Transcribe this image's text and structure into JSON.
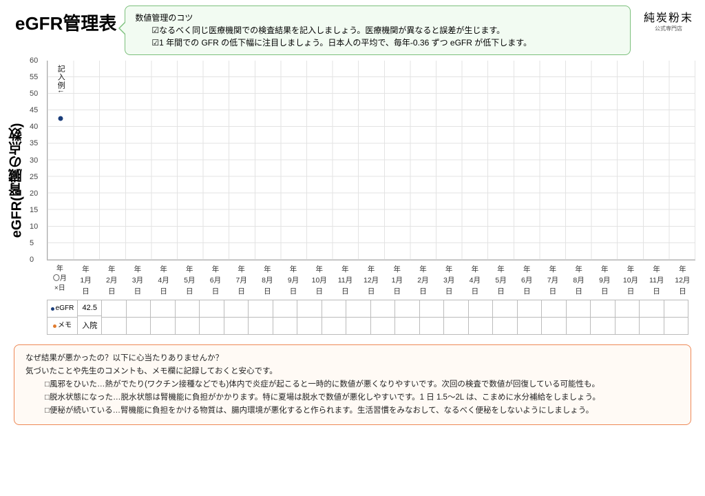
{
  "header": {
    "title": "eGFR管理表",
    "brand_line1": "純炭粉末",
    "brand_line2": "公式専門店",
    "tip_title": "数値管理のコツ",
    "tip1": "☑なるべく同じ医療機関での検査結果を記入しましょう。医療機関が異なると誤差が生じます。",
    "tip2": "☑1 年間での GFR の低下幅に注目しましょう。日本人の平均で、毎年-0.36 ずつ eGFR が低下します。"
  },
  "chart": {
    "ylabel": "eGFR(腎臓の点数)",
    "annotation": "記入例↓",
    "yticks": [
      "0",
      "5",
      "10",
      "15",
      "20",
      "25",
      "30",
      "35",
      "40",
      "45",
      "50",
      "55",
      "60"
    ]
  },
  "chart_data": {
    "type": "line",
    "title": "eGFR管理表",
    "ylabel": "eGFR(腎臓の点数)",
    "xlabel": "",
    "ylim": [
      0,
      60
    ],
    "categories": [
      "記入例",
      "1月",
      "2月",
      "3月",
      "4月",
      "5月",
      "6月",
      "7月",
      "8月",
      "9月",
      "10月",
      "11月",
      "12月",
      "1月",
      "2月",
      "3月",
      "4月",
      "5月",
      "6月",
      "7月",
      "8月",
      "9月",
      "10月",
      "11月",
      "12月"
    ],
    "series": [
      {
        "name": "eGFR",
        "values": [
          42.5,
          null,
          null,
          null,
          null,
          null,
          null,
          null,
          null,
          null,
          null,
          null,
          null,
          null,
          null,
          null,
          null,
          null,
          null,
          null,
          null,
          null,
          null,
          null,
          null
        ]
      },
      {
        "name": "メモ",
        "values": [
          "入院",
          "",
          "",
          "",
          "",
          "",
          "",
          "",
          "",
          "",
          "",
          "",
          "",
          "",
          "",
          "",
          "",
          "",
          "",
          "",
          "",
          "",
          "",
          "",
          ""
        ]
      }
    ]
  },
  "xaxis": {
    "first": {
      "l1": "年",
      "l2": "〇月",
      "l3": "×日"
    },
    "year": "年",
    "day": "日",
    "months": [
      "1月",
      "2月",
      "3月",
      "4月",
      "5月",
      "6月",
      "7月",
      "8月",
      "9月",
      "10月",
      "11月",
      "12月",
      "1月",
      "2月",
      "3月",
      "4月",
      "5月",
      "6月",
      "7月",
      "8月",
      "9月",
      "10月",
      "11月",
      "12月"
    ]
  },
  "table": {
    "header1": "eGFR",
    "header2": "メモ",
    "row1_first": "42.5",
    "row2_first": "入院"
  },
  "notes": {
    "l1": "なぜ結果が悪かったの？以下に心当たりありませんか？",
    "l2": "気づいたことや先生のコメントも、メモ欄に記録しておくと安心です。",
    "l3": "□風邪をひいた…熱がでたり(ワクチン接種などでも)体内で炎症が起こると一時的に数値が悪くなりやすいです。次回の検査で数値が回復している可能性も。",
    "l4": "□脱水状態になった…脱水状態は腎機能に負担がかかります。特に夏場は脱水で数値が悪化しやすいです。1 日 1.5～2L は、こまめに水分補給をしましょう。",
    "l5": "□便秘が続いている…腎機能に負担をかける物質は、腸内環境が悪化すると作られます。生活習慣をみなおして、なるべく便秘をしないようにしましょう。"
  }
}
